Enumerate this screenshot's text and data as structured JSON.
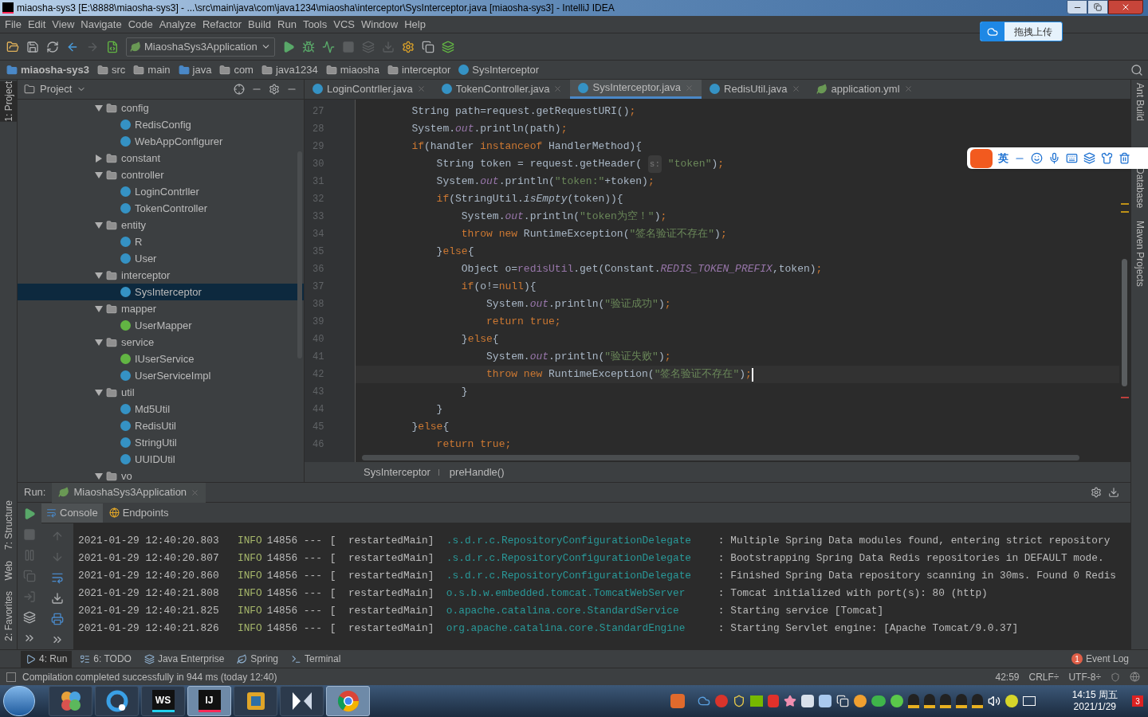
{
  "window": {
    "title": "miaosha-sys3 [E:\\8888\\miaosha-sys3] - ...\\src\\main\\java\\com\\java1234\\miaosha\\interceptor\\SysInterceptor.java [miaosha-sys3] - IntelliJ IDEA"
  },
  "menu": [
    "File",
    "Edit",
    "View",
    "Navigate",
    "Code",
    "Analyze",
    "Refactor",
    "Build",
    "Run",
    "Tools",
    "VCS",
    "Window",
    "Help"
  ],
  "upload_button": "拖拽上传",
  "run_config": "MiaoshaSys3Application",
  "breadcrumb": [
    {
      "label": "miaosha-sys3",
      "kind": "project"
    },
    {
      "label": "src",
      "kind": "folder"
    },
    {
      "label": "main",
      "kind": "folder"
    },
    {
      "label": "java",
      "kind": "source"
    },
    {
      "label": "com",
      "kind": "package"
    },
    {
      "label": "java1234",
      "kind": "package"
    },
    {
      "label": "miaosha",
      "kind": "package"
    },
    {
      "label": "interceptor",
      "kind": "package"
    },
    {
      "label": "SysInterceptor",
      "kind": "class"
    }
  ],
  "left_strip": [
    {
      "label": "1: Project",
      "selected": true
    },
    {
      "label": "7: Structure",
      "selected": false
    },
    {
      "label": "Web",
      "selected": false
    },
    {
      "label": "2: Favorites",
      "selected": false
    }
  ],
  "right_strip": [
    "Ant Build",
    "Database",
    "Maven Projects"
  ],
  "project_panel": {
    "title": "Project",
    "tree": [
      {
        "label": "config",
        "kind": "folder",
        "expanded": true,
        "selected": false,
        "children": [
          {
            "label": "RedisConfig",
            "kind": "class",
            "selected": false
          },
          {
            "label": "WebAppConfigurer",
            "kind": "class",
            "selected": false
          }
        ]
      },
      {
        "label": "constant",
        "kind": "folder",
        "expanded": false,
        "selected": false
      },
      {
        "label": "controller",
        "kind": "folder",
        "expanded": true,
        "selected": false,
        "children": [
          {
            "label": "LoginContrller",
            "kind": "class",
            "selected": false
          },
          {
            "label": "TokenController",
            "kind": "class",
            "selected": false
          }
        ]
      },
      {
        "label": "entity",
        "kind": "folder",
        "expanded": true,
        "selected": false,
        "children": [
          {
            "label": "R",
            "kind": "class",
            "selected": false
          },
          {
            "label": "User",
            "kind": "class",
            "selected": false
          }
        ]
      },
      {
        "label": "interceptor",
        "kind": "folder",
        "expanded": true,
        "selected": false,
        "children": [
          {
            "label": "SysInterceptor",
            "kind": "class",
            "selected": true
          }
        ]
      },
      {
        "label": "mapper",
        "kind": "folder",
        "expanded": true,
        "selected": false,
        "children": [
          {
            "label": "UserMapper",
            "kind": "interface",
            "selected": false
          }
        ]
      },
      {
        "label": "service",
        "kind": "folder",
        "expanded": true,
        "selected": false,
        "children": [
          {
            "label": "IUserService",
            "kind": "interface",
            "selected": false
          },
          {
            "label": "UserServiceImpl",
            "kind": "class",
            "selected": false
          }
        ]
      },
      {
        "label": "util",
        "kind": "folder",
        "expanded": true,
        "selected": false,
        "children": [
          {
            "label": "Md5Util",
            "kind": "class",
            "selected": false
          },
          {
            "label": "RedisUtil",
            "kind": "class",
            "selected": false
          },
          {
            "label": "StringUtil",
            "kind": "class",
            "selected": false
          },
          {
            "label": "UUIDUtil",
            "kind": "class",
            "selected": false
          }
        ]
      },
      {
        "label": "vo",
        "kind": "folder",
        "expanded": true,
        "selected": false
      }
    ]
  },
  "editor_tabs": [
    {
      "label": "LoginContrller.java",
      "kind": "class",
      "selected": false
    },
    {
      "label": "TokenController.java",
      "kind": "class",
      "selected": false
    },
    {
      "label": "SysInterceptor.java",
      "kind": "class",
      "selected": true
    },
    {
      "label": "RedisUtil.java",
      "kind": "class",
      "selected": false
    },
    {
      "label": "application.yml",
      "kind": "yaml",
      "selected": false
    }
  ],
  "code_lines": [
    {
      "num": "27",
      "current": false,
      "tokens": [
        {
          "kind": "plain",
          "text": "        String path=request.getRequestURI()"
        },
        {
          "kind": "keyword",
          "text": ";"
        }
      ]
    },
    {
      "num": "28",
      "current": false,
      "tokens": [
        {
          "kind": "plain",
          "text": "        System."
        },
        {
          "kind": "static",
          "text": "out"
        },
        {
          "kind": "plain",
          "text": ".println(path)"
        },
        {
          "kind": "keyword",
          "text": ";"
        }
      ]
    },
    {
      "num": "29",
      "current": false,
      "tokens": [
        {
          "kind": "keyword",
          "text": "        if"
        },
        {
          "kind": "plain",
          "text": "(handler "
        },
        {
          "kind": "keyword",
          "text": "instanceof"
        },
        {
          "kind": "plain",
          "text": " HandlerMethod){"
        }
      ]
    },
    {
      "num": "30",
      "current": false,
      "tokens": [
        {
          "kind": "plain",
          "text": "            String token = request.getHeader( "
        },
        {
          "kind": "hint",
          "text": "s:"
        },
        {
          "kind": "string",
          "text": " \"token\""
        },
        {
          "kind": "plain",
          "text": ")"
        },
        {
          "kind": "keyword",
          "text": ";"
        }
      ]
    },
    {
      "num": "31",
      "current": false,
      "tokens": [
        {
          "kind": "plain",
          "text": "            System."
        },
        {
          "kind": "static",
          "text": "out"
        },
        {
          "kind": "plain",
          "text": ".println("
        },
        {
          "kind": "string",
          "text": "\"token:\""
        },
        {
          "kind": "plain",
          "text": "+token)"
        },
        {
          "kind": "keyword",
          "text": ";"
        }
      ]
    },
    {
      "num": "32",
      "current": false,
      "tokens": [
        {
          "kind": "keyword",
          "text": "            if"
        },
        {
          "kind": "plain",
          "text": "(StringUtil."
        },
        {
          "kind": "italic",
          "text": "isEmpty"
        },
        {
          "kind": "plain",
          "text": "(token)){"
        }
      ]
    },
    {
      "num": "33",
      "current": false,
      "tokens": [
        {
          "kind": "plain",
          "text": "                System."
        },
        {
          "kind": "static",
          "text": "out"
        },
        {
          "kind": "plain",
          "text": ".println("
        },
        {
          "kind": "string",
          "text": "\"token为空！\""
        },
        {
          "kind": "plain",
          "text": ")"
        },
        {
          "kind": "keyword",
          "text": ";"
        }
      ]
    },
    {
      "num": "34",
      "current": false,
      "tokens": [
        {
          "kind": "keyword",
          "text": "                throw new"
        },
        {
          "kind": "plain",
          "text": " RuntimeException("
        },
        {
          "kind": "string",
          "text": "\"签名验证不存在\""
        },
        {
          "kind": "plain",
          "text": ")"
        },
        {
          "kind": "keyword",
          "text": ";"
        }
      ]
    },
    {
      "num": "35",
      "current": false,
      "tokens": [
        {
          "kind": "plain",
          "text": "            }"
        },
        {
          "kind": "keyword",
          "text": "else"
        },
        {
          "kind": "plain",
          "text": "{"
        }
      ]
    },
    {
      "num": "36",
      "current": false,
      "tokens": [
        {
          "kind": "plain",
          "text": "                Object o="
        },
        {
          "kind": "member",
          "text": "redisUtil"
        },
        {
          "kind": "plain",
          "text": ".get(Constant."
        },
        {
          "kind": "static",
          "text": "REDIS_TOKEN_PREFIX"
        },
        {
          "kind": "plain",
          "text": ",token)"
        },
        {
          "kind": "keyword",
          "text": ";"
        }
      ]
    },
    {
      "num": "37",
      "current": false,
      "tokens": [
        {
          "kind": "keyword",
          "text": "                if"
        },
        {
          "kind": "plain",
          "text": "(o!="
        },
        {
          "kind": "keyword",
          "text": "null"
        },
        {
          "kind": "plain",
          "text": "){"
        }
      ]
    },
    {
      "num": "38",
      "current": false,
      "tokens": [
        {
          "kind": "plain",
          "text": "                    System."
        },
        {
          "kind": "static",
          "text": "out"
        },
        {
          "kind": "plain",
          "text": ".println("
        },
        {
          "kind": "string",
          "text": "\"验证成功\""
        },
        {
          "kind": "plain",
          "text": ")"
        },
        {
          "kind": "keyword",
          "text": ";"
        }
      ]
    },
    {
      "num": "39",
      "current": false,
      "tokens": [
        {
          "kind": "keyword",
          "text": "                    return true;"
        }
      ]
    },
    {
      "num": "40",
      "current": false,
      "tokens": [
        {
          "kind": "plain",
          "text": "                }"
        },
        {
          "kind": "keyword",
          "text": "else"
        },
        {
          "kind": "plain",
          "text": "{"
        }
      ]
    },
    {
      "num": "41",
      "current": false,
      "tokens": [
        {
          "kind": "plain",
          "text": "                    System."
        },
        {
          "kind": "static",
          "text": "out"
        },
        {
          "kind": "plain",
          "text": ".println("
        },
        {
          "kind": "string",
          "text": "\"验证失败\""
        },
        {
          "kind": "plain",
          "text": ")"
        },
        {
          "kind": "keyword",
          "text": ";"
        }
      ]
    },
    {
      "num": "42",
      "current": true,
      "tokens": [
        {
          "kind": "keyword",
          "text": "                    throw new"
        },
        {
          "kind": "plain",
          "text": " RuntimeException("
        },
        {
          "kind": "string",
          "text": "\"签名验证不存在\""
        },
        {
          "kind": "plain",
          "text": ")"
        },
        {
          "kind": "keyword",
          "text": ";"
        }
      ]
    },
    {
      "num": "43",
      "current": false,
      "tokens": [
        {
          "kind": "plain",
          "text": "                }"
        }
      ]
    },
    {
      "num": "44",
      "current": false,
      "tokens": [
        {
          "kind": "plain",
          "text": "            }"
        }
      ]
    },
    {
      "num": "45",
      "current": false,
      "tokens": [
        {
          "kind": "plain",
          "text": "        }"
        },
        {
          "kind": "keyword",
          "text": "else"
        },
        {
          "kind": "plain",
          "text": "{"
        }
      ]
    },
    {
      "num": "46",
      "current": false,
      "tokens": [
        {
          "kind": "keyword",
          "text": "            return true;"
        }
      ]
    }
  ],
  "editor_breadcrumb": [
    "SysInterceptor",
    "preHandle()"
  ],
  "run_panel": {
    "label": "Run:",
    "tab": "MiaoshaSys3Application",
    "subtabs": [
      {
        "label": "Console",
        "selected": true
      },
      {
        "label": "Endpoints",
        "selected": false
      }
    ],
    "log": [
      {
        "time": "2021-01-29 12:40:20.803",
        "level": "INFO",
        "pid": "14856 ---",
        "thread": "[  restartedMain]",
        "logger": ".s.d.r.c.RepositoryConfigurationDelegate",
        "message": ": Multiple Spring Data modules found, entering strict repository"
      },
      {
        "time": "2021-01-29 12:40:20.807",
        "level": "INFO",
        "pid": "14856 ---",
        "thread": "[  restartedMain]",
        "logger": ".s.d.r.c.RepositoryConfigurationDelegate",
        "message": ": Bootstrapping Spring Data Redis repositories in DEFAULT mode."
      },
      {
        "time": "2021-01-29 12:40:20.860",
        "level": "INFO",
        "pid": "14856 ---",
        "thread": "[  restartedMain]",
        "logger": ".s.d.r.c.RepositoryConfigurationDelegate",
        "message": ": Finished Spring Data repository scanning in 30ms. Found 0 Redis"
      },
      {
        "time": "2021-01-29 12:40:21.808",
        "level": "INFO",
        "pid": "14856 ---",
        "thread": "[  restartedMain]",
        "logger": "o.s.b.w.embedded.tomcat.TomcatWebServer",
        "message": ": Tomcat initialized with port(s): 80 (http)"
      },
      {
        "time": "2021-01-29 12:40:21.825",
        "level": "INFO",
        "pid": "14856 ---",
        "thread": "[  restartedMain]",
        "logger": "o.apache.catalina.core.StandardService",
        "message": ": Starting service [Tomcat]"
      },
      {
        "time": "2021-01-29 12:40:21.826",
        "level": "INFO",
        "pid": "14856 ---",
        "thread": "[  restartedMain]",
        "logger": "org.apache.catalina.core.StandardEngine",
        "message": ": Starting Servlet engine: [Apache Tomcat/9.0.37]"
      }
    ]
  },
  "tool_windows": [
    {
      "label": "4: Run",
      "kind": "run",
      "selected": true
    },
    {
      "label": "6: TODO",
      "kind": "todo",
      "selected": false
    },
    {
      "label": "Java Enterprise",
      "kind": "enterprise",
      "selected": false
    },
    {
      "label": "Spring",
      "kind": "spring",
      "selected": false
    },
    {
      "label": "Terminal",
      "kind": "terminal",
      "selected": false
    }
  ],
  "event_log": {
    "label": "Event Log",
    "count": "1"
  },
  "status_bar": {
    "message": "Compilation completed successfully in 944 ms (today 12:40)",
    "position": "42:59",
    "line_separator": "CRLF÷",
    "encoding": "UTF-8÷"
  },
  "ime_bar": {
    "mode": "英"
  },
  "taskbar": {
    "apps": [
      {
        "kind": "pinwheel",
        "selected": false
      },
      {
        "kind": "qq-browser",
        "selected": false
      },
      {
        "kind": "webstorm",
        "label": "WS",
        "selected": false
      },
      {
        "kind": "intellij",
        "label": "IJ",
        "selected": true
      },
      {
        "kind": "box",
        "selected": false
      },
      {
        "kind": "xmind",
        "selected": false
      },
      {
        "kind": "chrome",
        "selected": true
      }
    ],
    "clock_time": "14:15 周五",
    "clock_date": "2021/1/29",
    "notification_count": "3"
  }
}
